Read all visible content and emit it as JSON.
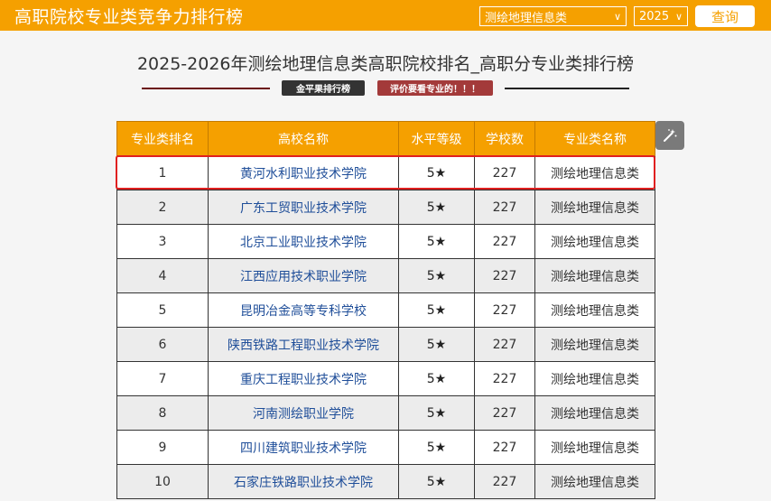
{
  "header": {
    "title": "高职院校专业类竞争力排行榜",
    "category_select": "测绘地理信息类",
    "year_select": "2025",
    "query_label": "查询"
  },
  "heading": {
    "title": "2025-2026年测绘地理信息类高职院校排名_高职分专业类排行榜",
    "tag_brand": "金平果排行榜",
    "tag_note": "评价要看专业的！！！"
  },
  "table": {
    "columns": [
      "专业类排名",
      "高校名称",
      "水平等级",
      "学校数",
      "专业类名称"
    ],
    "rows": [
      {
        "rank": "1",
        "school": "黄河水利职业技术学院",
        "level": "5★",
        "count": "227",
        "category": "测绘地理信息类"
      },
      {
        "rank": "2",
        "school": "广东工贸职业技术学院",
        "level": "5★",
        "count": "227",
        "category": "测绘地理信息类"
      },
      {
        "rank": "3",
        "school": "北京工业职业技术学院",
        "level": "5★",
        "count": "227",
        "category": "测绘地理信息类"
      },
      {
        "rank": "4",
        "school": "江西应用技术职业学院",
        "level": "5★",
        "count": "227",
        "category": "测绘地理信息类"
      },
      {
        "rank": "5",
        "school": "昆明冶金高等专科学校",
        "level": "5★",
        "count": "227",
        "category": "测绘地理信息类"
      },
      {
        "rank": "6",
        "school": "陕西铁路工程职业技术学院",
        "level": "5★",
        "count": "227",
        "category": "测绘地理信息类"
      },
      {
        "rank": "7",
        "school": "重庆工程职业技术学院",
        "level": "5★",
        "count": "227",
        "category": "测绘地理信息类"
      },
      {
        "rank": "8",
        "school": "河南测绘职业学院",
        "level": "5★",
        "count": "227",
        "category": "测绘地理信息类"
      },
      {
        "rank": "9",
        "school": "四川建筑职业技术学院",
        "level": "5★",
        "count": "227",
        "category": "测绘地理信息类"
      },
      {
        "rank": "10",
        "school": "石家庄铁路职业技术学院",
        "level": "5★",
        "count": "227",
        "category": "测绘地理信息类"
      }
    ]
  },
  "colors": {
    "brand": "#f5a000",
    "link": "#1f4e99",
    "highlight": "#e02020"
  },
  "icons": {
    "wand": "magic-wand-icon",
    "caret": "chevron-down-icon"
  }
}
